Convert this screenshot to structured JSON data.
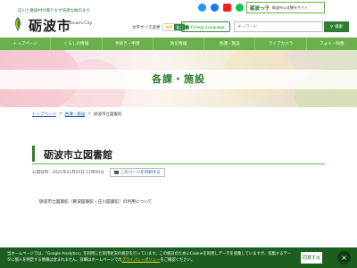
{
  "header": {
    "tagline": "庄川と散居村が織りなす快適な緑のまち",
    "city_name": "砺波市",
    "city_name_en": "Tonami City",
    "font_size_label": "文字サイズ変更",
    "font_size_small": "標準",
    "font_size_large": "拡大",
    "language_button": "Foreign Language",
    "search_placeholder": "キーワード",
    "search_button": "検索",
    "kids_title": "砺波っ子",
    "kids_sub": "砺波市公式観光サイト"
  },
  "social": [
    "twitter-icon",
    "facebook-icon",
    "youtube-icon",
    "line-icon"
  ],
  "nav": {
    "items": [
      "トップページ",
      "くらしの情報",
      "手続き・申請",
      "防災情報",
      "各課・施設",
      "ライブカメラ",
      "フォト・映像"
    ]
  },
  "hero": {
    "title": "各課・施設"
  },
  "breadcrumb": [
    "トップページ",
    "各課・施設",
    "砺波市立図書館"
  ],
  "main": {
    "title": "砺波市立図書館",
    "updated": "公開日時：2021年01月05日 11時00分",
    "print_label": "このページを印刷する",
    "body": "砺波市立図書館（砺波図書館・庄川図書館）の利用について"
  },
  "cookie": {
    "text_1": "当ホームページでは、「Google Analytics」を利用した利用状況の統計を行っています。この統計のためにCookieを利用しデータを収集しています",
    "text_2": "が、収集するデータに個人を特定する情報は含まれません。詳細はホームページでの",
    "link": "プライバシーポリシー",
    "text_3": "をご確認ください。",
    "agree_label": "同意する",
    "close_label": "×"
  },
  "colors": {
    "primary_green": "#2e7d32",
    "nav_green": "#6ab04c",
    "cookie_bg": "#1b5e20"
  }
}
